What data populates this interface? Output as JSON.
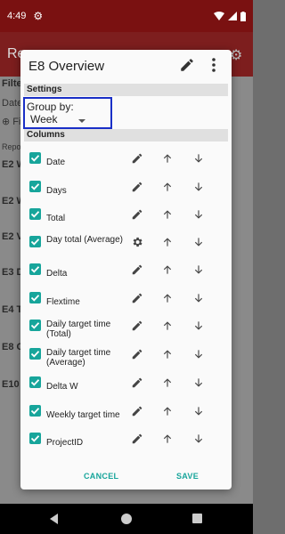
{
  "status": {
    "time": "4:49"
  },
  "background": {
    "app_title": "Re",
    "filter_label": "Filte",
    "date_label": "Date",
    "fi_link": "Fi",
    "reports_label": "Repo",
    "items": [
      "E2 W",
      "E2 W",
      "E2 V",
      "E3 D",
      "E4 T",
      "E8 C",
      "E10"
    ]
  },
  "dialog": {
    "title": "E8 Overview",
    "settings_header": "Settings",
    "group_by_label": "Group by:",
    "group_by_value": "Week",
    "columns_header": "Columns",
    "columns": [
      {
        "label": "Date",
        "checked": true,
        "action": "edit"
      },
      {
        "label": "Days",
        "checked": true,
        "action": "edit"
      },
      {
        "label": "Total",
        "checked": true,
        "action": "edit"
      },
      {
        "label": "Day total (Average)",
        "checked": true,
        "action": "settings"
      },
      {
        "label": "Delta",
        "checked": true,
        "action": "edit"
      },
      {
        "label": "Flextime",
        "checked": true,
        "action": "edit"
      },
      {
        "label": "Daily target time (Total)",
        "checked": true,
        "action": "edit"
      },
      {
        "label": "Daily target time (Average)",
        "checked": true,
        "action": "edit"
      },
      {
        "label": "Delta W",
        "checked": true,
        "action": "edit"
      },
      {
        "label": "Weekly target time",
        "checked": true,
        "action": "edit"
      },
      {
        "label": "ProjectID",
        "checked": true,
        "action": "edit"
      }
    ],
    "cancel_label": "CANCEL",
    "save_label": "SAVE"
  },
  "colors": {
    "accent": "#17a59b",
    "primary_dark": "#7a1111",
    "highlight_border": "#1a2fc7"
  }
}
